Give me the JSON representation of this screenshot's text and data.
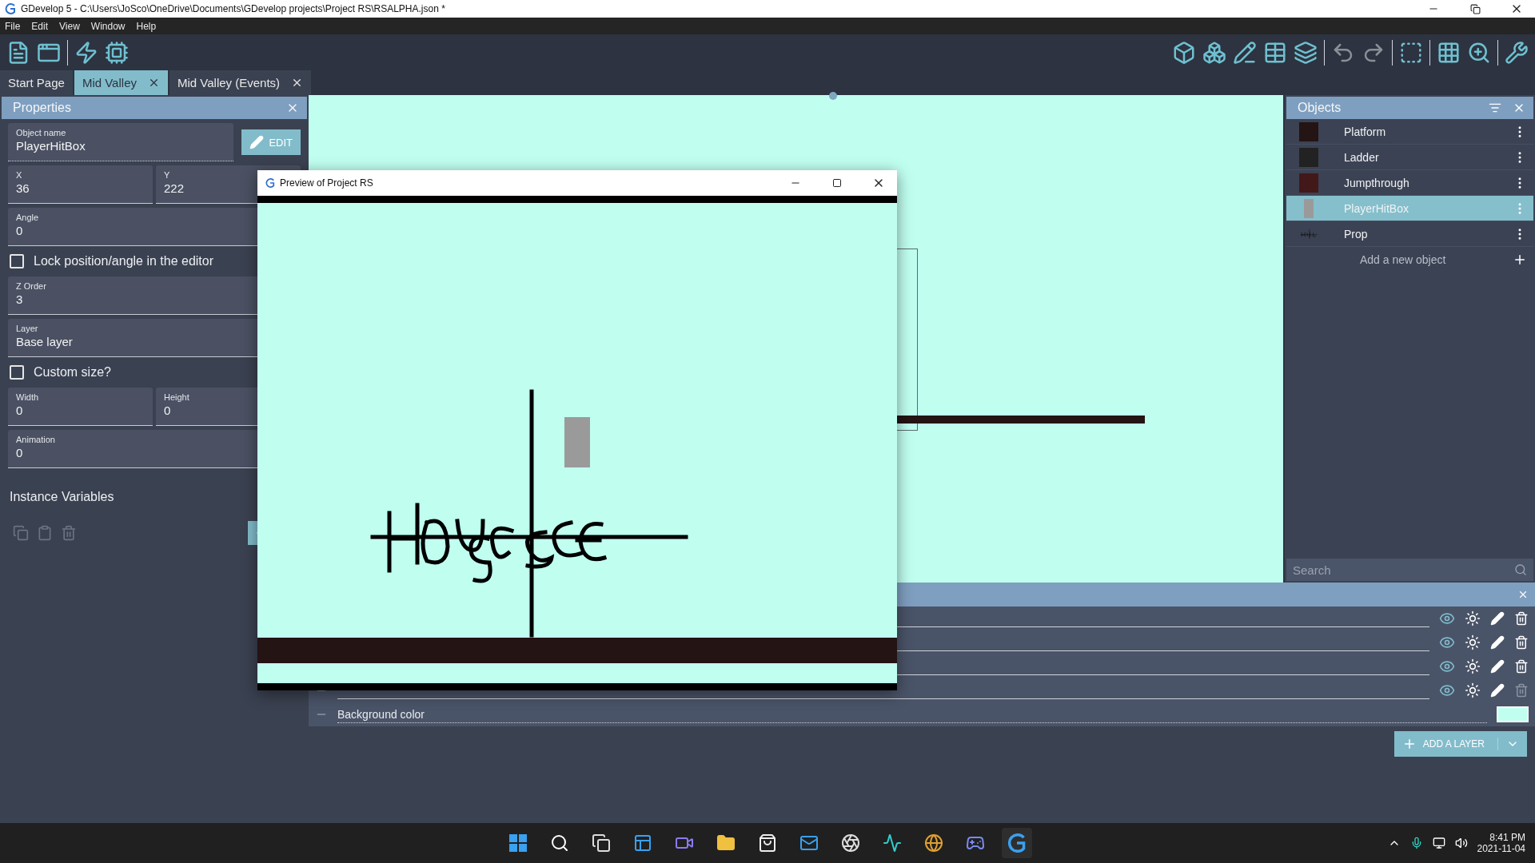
{
  "window": {
    "title": "GDevelop 5 - C:\\Users\\JoSco\\OneDrive\\Documents\\GDevelop projects\\Project RS\\RSALPHA.json *"
  },
  "menu": [
    "File",
    "Edit",
    "View",
    "Window",
    "Help"
  ],
  "tabs": [
    {
      "label": "Start Page",
      "selected": false,
      "closable": false
    },
    {
      "label": "Mid Valley",
      "selected": true,
      "closable": true
    },
    {
      "label": "Mid Valley (Events)",
      "selected": false,
      "closable": true
    }
  ],
  "properties": {
    "title": "Properties",
    "edit_button": "EDIT",
    "rows": [
      {
        "kind": "name",
        "fields": [
          {
            "label": "Object name",
            "value": "PlayerHitBox"
          }
        ]
      },
      {
        "kind": "fields",
        "fields": [
          {
            "label": "X",
            "value": "36"
          },
          {
            "label": "Y",
            "value": "222"
          }
        ]
      },
      {
        "kind": "fields",
        "fields": [
          {
            "label": "Angle",
            "value": "0"
          }
        ]
      },
      {
        "kind": "checkbox",
        "label": "Lock position/angle in the editor",
        "checked": false
      },
      {
        "kind": "fields",
        "fields": [
          {
            "label": "Z Order",
            "value": "3"
          }
        ]
      },
      {
        "kind": "fields",
        "fields": [
          {
            "label": "Layer",
            "value": "Base layer"
          }
        ]
      },
      {
        "kind": "checkbox",
        "label": "Custom size?",
        "checked": false
      },
      {
        "kind": "fields",
        "fields": [
          {
            "label": "Width",
            "value": "0"
          },
          {
            "label": "Height",
            "value": "0"
          }
        ]
      },
      {
        "kind": "fields",
        "fields": [
          {
            "label": "Animation",
            "value": "0"
          }
        ]
      }
    ],
    "variables_title": "Instance Variables"
  },
  "objects": {
    "title": "Objects",
    "items": [
      {
        "name": "Platform",
        "kind": "swatch",
        "color": "#241414",
        "selected": false
      },
      {
        "name": "Ladder",
        "kind": "swatch",
        "color": "#222222",
        "selected": false
      },
      {
        "name": "Jumpthrough",
        "kind": "swatch",
        "color": "#431818",
        "selected": false
      },
      {
        "name": "PlayerHitBox",
        "kind": "block",
        "selected": true
      },
      {
        "name": "Prop",
        "kind": "sketch",
        "selected": false
      }
    ],
    "add_label": "Add a new object",
    "search": {
      "placeholder": "Search"
    }
  },
  "layers": {
    "rows": [
      {
        "deletable": true
      },
      {
        "deletable": true
      },
      {
        "deletable": true
      },
      {
        "deletable": false
      }
    ],
    "background": {
      "label": "Background color",
      "color": "#c0fff0"
    },
    "add_button": "ADD A LAYER"
  },
  "preview": {
    "title": "Preview of Project RS"
  },
  "taskbar": {
    "time": "8:41 PM",
    "date": "2021-11-04"
  }
}
